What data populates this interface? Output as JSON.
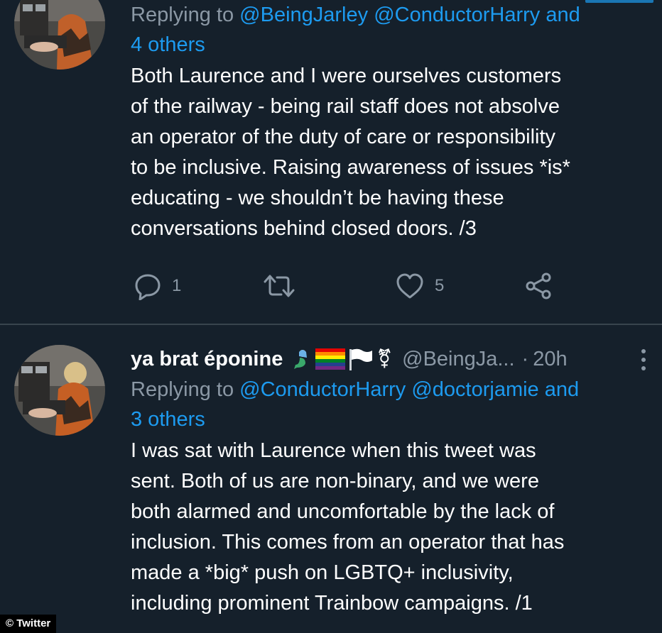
{
  "tweets": [
    {
      "replying_prefix": "Replying to ",
      "mentions": [
        "@BeingJarley",
        "@ConductorHarry"
      ],
      "and_others": "and",
      "others_count": "4 others",
      "body": "Both Laurence and I were ourselves customers\nof the railway - being rail staff does not absolve\nan operator of the duty of care or responsibility\nto be inclusive. Raising awareness of issues *is*\neducating - we shouldn’t be having these\nconversations behind closed doors. /3",
      "actions": {
        "reply_count": "1",
        "retweet_count": "",
        "like_count": "5"
      }
    },
    {
      "display_name": "ya brat éponine",
      "emoji_icons": [
        "mermaid-emoji",
        "rainbow-flag-emoji",
        "white-flag-emoji",
        "transgender-symbol-emoji"
      ],
      "transgender_symbol": "⚧",
      "handle": "@BeingJa...",
      "separator": "·",
      "time": "20h",
      "replying_prefix": "Replying to ",
      "mentions": [
        "@ConductorHarry",
        "@doctorjamie"
      ],
      "and_others": "and",
      "others_count": "3 others",
      "body": "I was sat with Laurence when this tweet was\nsent. Both of us are non-binary, and we were\nboth alarmed and uncomfortable by the lack of\ninclusion. This comes from an operator that has\nmade a *big* push on LGBTQ+ inclusivity,\nincluding prominent Trainbow campaigns. /1"
    }
  ],
  "watermark": "© Twitter",
  "colors": {
    "background": "#15202b",
    "mention": "#1d9bf0",
    "secondary_text": "#8b98a5",
    "divider": "#38444d"
  }
}
